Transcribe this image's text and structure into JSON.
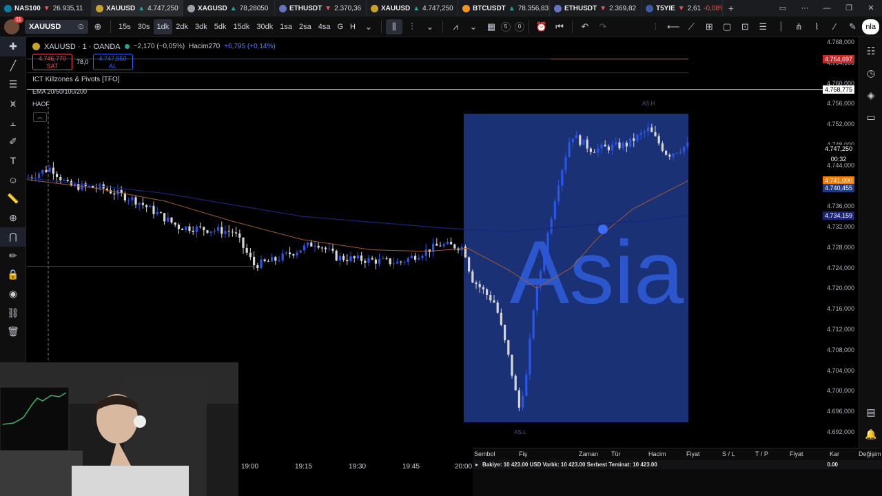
{
  "tabs": [
    {
      "sym": "NAS100",
      "dir": "dn",
      "arrow": "▼",
      "price": "26.935,11",
      "color": "#0b7fa5",
      "active": false
    },
    {
      "sym": "XAUUSD",
      "dir": "up",
      "arrow": "▲",
      "price": "4.747,250",
      "color": "#c9a227",
      "active": true
    },
    {
      "sym": "XAGUSD",
      "dir": "up",
      "arrow": "▲",
      "price": "78,28050",
      "color": "#9aa0a6",
      "active": false
    },
    {
      "sym": "ETHUSDT",
      "dir": "dn",
      "arrow": "▼",
      "price": "2.370,36",
      "color": "#6573c3",
      "active": false
    },
    {
      "sym": "XAUUSD",
      "dir": "up",
      "arrow": "▲",
      "price": "4.747,250",
      "color": "#c9a227",
      "active": false
    },
    {
      "sym": "BTCUSDT",
      "dir": "up",
      "arrow": "▲",
      "price": "78.356,83",
      "color": "#f7931a",
      "active": false
    },
    {
      "sym": "ETHUSDT",
      "dir": "dn",
      "arrow": "▼",
      "price": "2.369,82",
      "color": "#6573c3",
      "active": false
    },
    {
      "sym": "T5YIE",
      "dir": "dn",
      "arrow": "▼",
      "price": "2,61",
      "change": "-0,08%",
      "color": "#3c5aa6",
      "active": false
    }
  ],
  "toolbar": {
    "symbol": "XAUUSD",
    "avatar_badge": "11",
    "intervals": [
      "15s",
      "30s",
      "1dk",
      "2dk",
      "3dk",
      "5dk",
      "15dk",
      "30dk",
      "1sa",
      "2sa",
      "4sa",
      "G",
      "H"
    ],
    "selected_interval": "1dk",
    "counter_a": "5",
    "counter_b": "0",
    "publish_label": "nla"
  },
  "legend": {
    "title": "XAUUSD · 1 · OANDA",
    "change": "−2,170 (−0,05%)",
    "volume_label": "Hacim",
    "volume": "270",
    "volume_change": "+6,795 (+0,14%)",
    "sell_price": "4.746,770",
    "sell_label": "SAT",
    "spread": "78,0",
    "buy_price": "4.747,550",
    "buy_label": "AL",
    "indicator1": "ICT Killzones & Pivots [TFO]",
    "indicator2": "EMA 20/50/100/200",
    "indicator3": "HAOF",
    "collapse_icon": "chevron-up-icon"
  },
  "chart_overlay": {
    "session_label": "Asia",
    "session_high": "AS.H",
    "session_low": "AS.L",
    "session_color": "#1e3a8a"
  },
  "price_axis": {
    "labels": [
      "4.768,000",
      "4.764,000",
      "4.760,000",
      "4.756,000",
      "4.752,000",
      "4.748,000",
      "4.744,000",
      "4.740,000",
      "4.736,000",
      "4.732,000",
      "4.728,000",
      "4.724,000",
      "4.720,000",
      "4.716,000",
      "4.712,000",
      "4.708,000",
      "4.704,000",
      "4.700,000",
      "4.696,000",
      "4.692,000"
    ],
    "tags": [
      {
        "value": "4.764,697",
        "bg": "#c62828",
        "fg": "#ffffff"
      },
      {
        "value": "4.758,775",
        "bg": "#ffffff",
        "fg": "#000000"
      },
      {
        "value": "4.747,250",
        "bg": "#000000",
        "fg": "#ffffff"
      },
      {
        "value": "00:32",
        "bg": "#000000",
        "fg": "#ffffff"
      },
      {
        "value": "4.741,000",
        "bg": "#f57c00",
        "fg": "#ffffff"
      },
      {
        "value": "4.740,455",
        "bg": "#1e3a8a",
        "fg": "#ffffff"
      },
      {
        "value": "4.734,159",
        "bg": "#1a237e",
        "fg": "#ffffff"
      }
    ]
  },
  "time_axis": {
    "labels": [
      "19:00",
      "19:15",
      "19:30",
      "19:45",
      "20:00"
    ]
  },
  "orders": {
    "columns": [
      "Sembol",
      "Fiş",
      "Zaman",
      "Tür",
      "Hacim",
      "Fiyat",
      "S / L",
      "T / P",
      "Fiyat",
      "Kar",
      "Değişim"
    ],
    "summary": "Bakiye: 10 423.00 USD  Varlık: 10 423.00  Serbest Teminat: 10 423.00",
    "profit_total": "0.00"
  },
  "webcam": {
    "label": "webcam-overlay"
  }
}
